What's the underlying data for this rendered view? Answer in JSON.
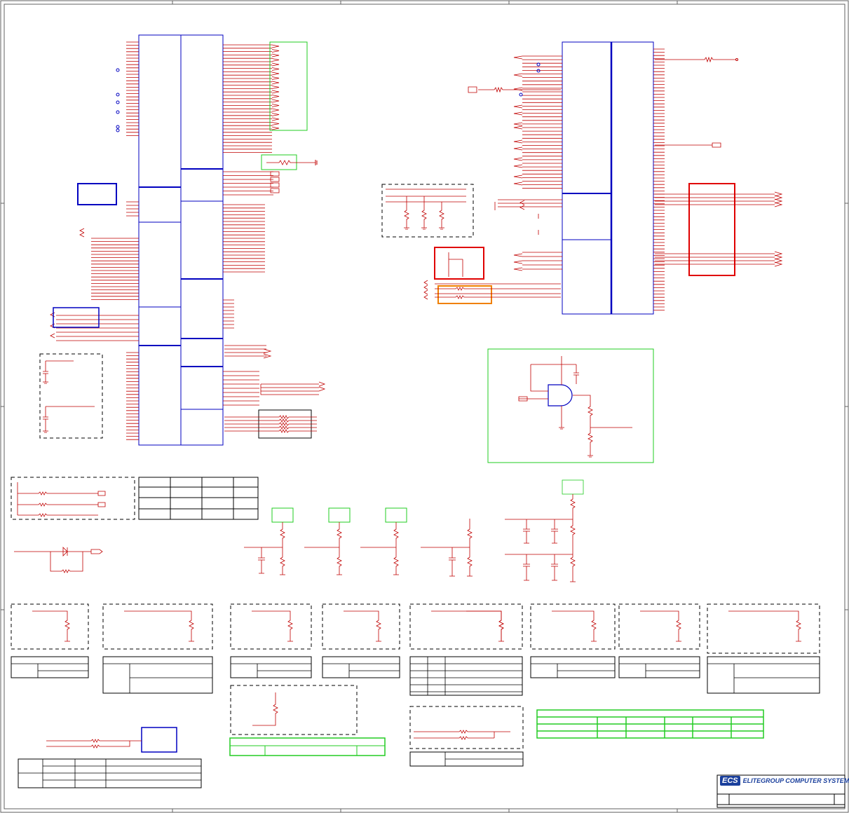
{
  "title_block": {
    "logo_mark": "ECS",
    "company": "ELITEGROUP COMPUTER SYSTEMS"
  },
  "colors": {
    "wire": "#c00000",
    "part": "#0000c0",
    "frame": "#606060",
    "group_box": "#22cc22",
    "highlight_red": "#e00000",
    "highlight_orange": "#f08000"
  }
}
